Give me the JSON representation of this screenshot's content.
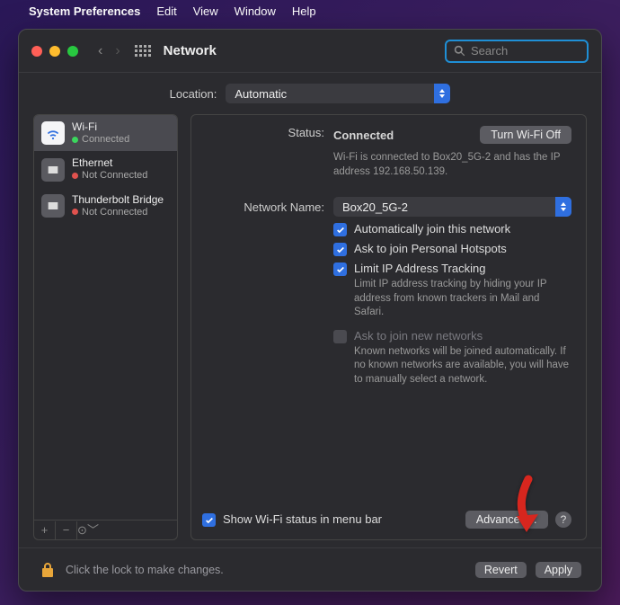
{
  "menubar": {
    "app": "System Preferences",
    "items": [
      "Edit",
      "View",
      "Window",
      "Help"
    ]
  },
  "window": {
    "title": "Network",
    "search_placeholder": "Search"
  },
  "location": {
    "label": "Location:",
    "value": "Automatic"
  },
  "services": [
    {
      "name": "Wi-Fi",
      "status": "Connected",
      "dot": "g",
      "icon": "wifi",
      "selected": true
    },
    {
      "name": "Ethernet",
      "status": "Not Connected",
      "dot": "r",
      "icon": "eth",
      "selected": false
    },
    {
      "name": "Thunderbolt Bridge",
      "status": "Not Connected",
      "dot": "r",
      "icon": "eth",
      "selected": false
    }
  ],
  "detail": {
    "status_label": "Status:",
    "status_value": "Connected",
    "toggle_label": "Turn Wi-Fi Off",
    "status_desc": "Wi-Fi is connected to Box20_5G-2 and has the IP address 192.168.50.139.",
    "network_label": "Network Name:",
    "network_value": "Box20_5G-2",
    "opts": {
      "auto_join": "Automatically join this network",
      "hotspots": "Ask to join Personal Hotspots",
      "limit_ip": "Limit IP Address Tracking",
      "limit_ip_desc": "Limit IP address tracking by hiding your IP address from known trackers in Mail and Safari.",
      "ask_new": "Ask to join new networks",
      "ask_new_desc": "Known networks will be joined automatically. If no known networks are available, you will have to manually select a network."
    },
    "show_menu": "Show Wi-Fi status in menu bar",
    "advanced": "Advanced…"
  },
  "footer": {
    "lock_text": "Click the lock to make changes.",
    "revert": "Revert",
    "apply": "Apply"
  }
}
